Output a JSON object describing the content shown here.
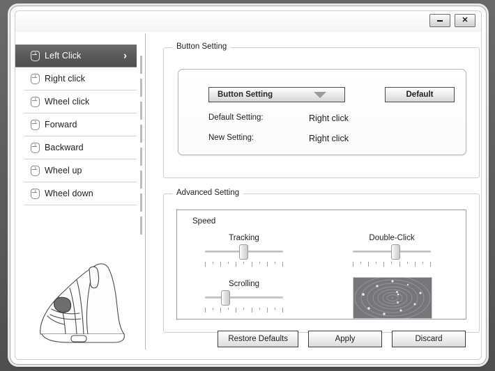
{
  "window": {
    "title": "",
    "minimize_label": "–",
    "close_label": "✕"
  },
  "sidebar": {
    "items": [
      {
        "label": "Left Click",
        "icon": "mouse-icon",
        "selected": true,
        "chevron": "›"
      },
      {
        "label": "Right click",
        "icon": "mouse-icon",
        "selected": false,
        "chevron": ""
      },
      {
        "label": "Wheel click",
        "icon": "mouse-icon",
        "selected": false,
        "chevron": ""
      },
      {
        "label": "Forward",
        "icon": "mouse-icon",
        "selected": false,
        "chevron": ""
      },
      {
        "label": "Backward",
        "icon": "mouse-icon",
        "selected": false,
        "chevron": ""
      },
      {
        "label": "Wheel up",
        "icon": "mouse-icon",
        "selected": false,
        "chevron": ""
      },
      {
        "label": "Wheel down",
        "icon": "mouse-icon",
        "selected": false,
        "chevron": ""
      }
    ],
    "illustration": "vertical-ergonomic-mouse-line-art"
  },
  "button_setting": {
    "group_title": "Button Setting",
    "dropdown_value": "Button Setting",
    "dropdown_icon": "chevron-down-icon",
    "default_button_label": "Default",
    "rows": [
      {
        "key": "Default Setting:",
        "value": "Right click"
      },
      {
        "key": "New Setting:",
        "value": "Right click"
      }
    ]
  },
  "advanced_setting": {
    "group_title": "Advanced Setting",
    "speed_label": "Speed",
    "sliders": [
      {
        "label": "Tracking",
        "value_pct": 48
      },
      {
        "label": "Scrolling",
        "value_pct": 25
      },
      {
        "label": "Double-Click",
        "value_pct": 54
      }
    ],
    "tick_count": 11,
    "test_area": "double-click-test-pad"
  },
  "footer": {
    "buttons": [
      {
        "label": "Restore Defaults"
      },
      {
        "label": "Apply"
      },
      {
        "label": "Discard"
      }
    ]
  },
  "colors": {
    "selected_item": "#5a5a5a",
    "window_bg": "#ffffff",
    "page_bg": "#5e5e5e",
    "border": "#cecece",
    "test_pad": "#77777b"
  }
}
